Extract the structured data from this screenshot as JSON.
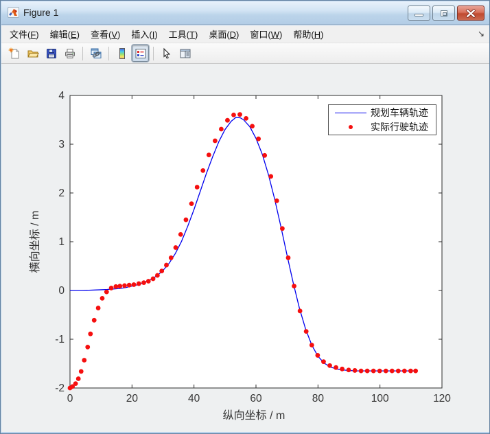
{
  "window": {
    "title": "Figure 1",
    "controls": [
      {
        "name": "minimize"
      },
      {
        "name": "restore"
      },
      {
        "name": "close"
      }
    ]
  },
  "menu": {
    "items": [
      {
        "label": "文件",
        "key": "F"
      },
      {
        "label": "编辑",
        "key": "E"
      },
      {
        "label": "查看",
        "key": "V"
      },
      {
        "label": "插入",
        "key": "I"
      },
      {
        "label": "工具",
        "key": "T"
      },
      {
        "label": "桌面",
        "key": "D"
      },
      {
        "label": "窗口",
        "key": "W"
      },
      {
        "label": "帮助",
        "key": "H"
      }
    ],
    "overflow_glyph": "↘"
  },
  "toolbar": {
    "buttons": [
      {
        "name": "new-figure",
        "pressed": false
      },
      {
        "name": "open-file",
        "pressed": false
      },
      {
        "name": "save-figure",
        "pressed": false
      },
      {
        "name": "print-figure",
        "pressed": false
      },
      {
        "name": "link-plot",
        "pressed": false
      },
      {
        "name": "insert-colorbar",
        "pressed": false
      },
      {
        "name": "insert-legend",
        "pressed": true
      },
      {
        "name": "edit-plot",
        "pressed": false
      },
      {
        "name": "plot-tools",
        "pressed": false
      }
    ]
  },
  "chart_data": {
    "type": "line",
    "title": "",
    "xlabel": "纵向坐标 / m",
    "ylabel": "横向坐标 / m",
    "xlim": [
      0,
      120
    ],
    "ylim": [
      -2,
      4
    ],
    "xticks": [
      0,
      20,
      40,
      60,
      80,
      100,
      120
    ],
    "yticks": [
      -2,
      -1,
      0,
      1,
      2,
      3,
      4
    ],
    "grid": false,
    "legend_position": "top-right",
    "axis_color": "#2b2b2b",
    "plot_bg": "#ffffff",
    "series": [
      {
        "name": "规划车辆轨迹",
        "type": "line",
        "color": "#0000ee",
        "points": [
          [
            0,
            0
          ],
          [
            4,
            0
          ],
          [
            8,
            0.01
          ],
          [
            12,
            0.02
          ],
          [
            14,
            0.03
          ],
          [
            16,
            0.04
          ],
          [
            18,
            0.06
          ],
          [
            20,
            0.09
          ],
          [
            22,
            0.12
          ],
          [
            24,
            0.17
          ],
          [
            26,
            0.22
          ],
          [
            28,
            0.3
          ],
          [
            30,
            0.41
          ],
          [
            32,
            0.56
          ],
          [
            34,
            0.76
          ],
          [
            36,
            1.01
          ],
          [
            38,
            1.32
          ],
          [
            40,
            1.66
          ],
          [
            42,
            2.03
          ],
          [
            44,
            2.4
          ],
          [
            46,
            2.74
          ],
          [
            48,
            3.05
          ],
          [
            50,
            3.3
          ],
          [
            52,
            3.47
          ],
          [
            53.5,
            3.55
          ],
          [
            55,
            3.54
          ],
          [
            56,
            3.5
          ],
          [
            58,
            3.36
          ],
          [
            60,
            3.12
          ],
          [
            62,
            2.8
          ],
          [
            64,
            2.38
          ],
          [
            66,
            1.88
          ],
          [
            68,
            1.32
          ],
          [
            70,
            0.73
          ],
          [
            72,
            0.16
          ],
          [
            74,
            -0.36
          ],
          [
            76,
            -0.79
          ],
          [
            78,
            -1.12
          ],
          [
            80,
            -1.35
          ],
          [
            82,
            -1.49
          ],
          [
            84,
            -1.57
          ],
          [
            86,
            -1.61
          ],
          [
            88,
            -1.63
          ],
          [
            90,
            -1.64
          ],
          [
            92,
            -1.65
          ],
          [
            96,
            -1.65
          ],
          [
            100,
            -1.65
          ],
          [
            104,
            -1.65
          ],
          [
            108,
            -1.65
          ],
          [
            111,
            -1.65
          ]
        ]
      },
      {
        "name": "实际行驶轨迹",
        "type": "scatter",
        "color": "#f50f0f",
        "marker": "dot",
        "points": [
          [
            0,
            -2
          ],
          [
            0.8,
            -1.97
          ],
          [
            1.8,
            -1.91
          ],
          [
            2.7,
            -1.81
          ],
          [
            3.6,
            -1.66
          ],
          [
            4.6,
            -1.43
          ],
          [
            5.7,
            -1.16
          ],
          [
            6.6,
            -0.89
          ],
          [
            7.8,
            -0.61
          ],
          [
            9.1,
            -0.36
          ],
          [
            10.4,
            -0.16
          ],
          [
            11.8,
            -0.03
          ],
          [
            13.3,
            0.05
          ],
          [
            14.8,
            0.08
          ],
          [
            16.1,
            0.09
          ],
          [
            17.6,
            0.1
          ],
          [
            19.1,
            0.11
          ],
          [
            20.6,
            0.12
          ],
          [
            22.2,
            0.14
          ],
          [
            23.8,
            0.16
          ],
          [
            25.3,
            0.19
          ],
          [
            26.8,
            0.24
          ],
          [
            28.2,
            0.31
          ],
          [
            29.6,
            0.4
          ],
          [
            31.1,
            0.52
          ],
          [
            32.6,
            0.67
          ],
          [
            34.1,
            0.88
          ],
          [
            35.7,
            1.15
          ],
          [
            37.4,
            1.45
          ],
          [
            39.2,
            1.78
          ],
          [
            41,
            2.12
          ],
          [
            42.9,
            2.46
          ],
          [
            44.8,
            2.78
          ],
          [
            46.8,
            3.07
          ],
          [
            48.8,
            3.31
          ],
          [
            50.8,
            3.49
          ],
          [
            52.8,
            3.6
          ],
          [
            54.8,
            3.61
          ],
          [
            56.8,
            3.53
          ],
          [
            58.8,
            3.37
          ],
          [
            60.8,
            3.11
          ],
          [
            62.8,
            2.77
          ],
          [
            64.8,
            2.34
          ],
          [
            66.7,
            1.84
          ],
          [
            68.5,
            1.27
          ],
          [
            70.4,
            0.67
          ],
          [
            72.3,
            0.09
          ],
          [
            74.2,
            -0.42
          ],
          [
            76.2,
            -0.84
          ],
          [
            78,
            -1.12
          ],
          [
            79.9,
            -1.33
          ],
          [
            81.8,
            -1.46
          ],
          [
            83.8,
            -1.54
          ],
          [
            85.8,
            -1.58
          ],
          [
            87.8,
            -1.61
          ],
          [
            89.9,
            -1.63
          ],
          [
            91.9,
            -1.64
          ],
          [
            93.9,
            -1.65
          ],
          [
            95.9,
            -1.65
          ],
          [
            97.9,
            -1.65
          ],
          [
            99.9,
            -1.65
          ],
          [
            101.9,
            -1.65
          ],
          [
            103.9,
            -1.65
          ],
          [
            105.9,
            -1.65
          ],
          [
            107.9,
            -1.65
          ],
          [
            109.9,
            -1.65
          ],
          [
            111.5,
            -1.65
          ]
        ]
      }
    ]
  }
}
